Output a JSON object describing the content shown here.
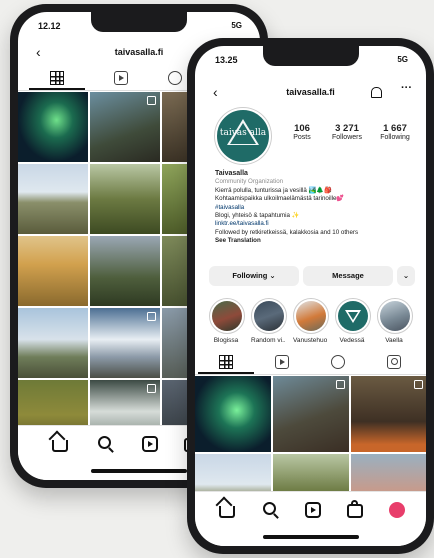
{
  "back_phone": {
    "status_time": "12.12",
    "status_signal": "5G",
    "username": "taivasalla.fi",
    "back_symbol": "‹"
  },
  "front_phone": {
    "status_time": "13.25",
    "status_signal": "5G",
    "username": "taivasalla.fi",
    "back_symbol": "‹",
    "avatar_logo_text": "taivas alla",
    "stats": [
      {
        "value": "106",
        "label": "Posts"
      },
      {
        "value": "3 271",
        "label": "Followers"
      },
      {
        "value": "1 667",
        "label": "Following"
      }
    ],
    "bio": {
      "name": "Taivasalla",
      "category": "Community Organization",
      "line1": "Kierrä polulla, tunturissa ja vesillä 🏞️🌲🎒",
      "line2": "Kohtaamispaikka ulkoilmaelämästä tarinoille💕",
      "hashtag": "#taivasalla",
      "line3": "Blogi, yhteisö & tapahtumia ✨",
      "link": "linktr.ee/taivasalla.fi",
      "followed_by": "Followed by retkiretkeissä, kalakkosia and 10 others",
      "see_translation": "See Translation"
    },
    "buttons": {
      "following": "Following ⌄",
      "message": "Message",
      "more": "⌄"
    },
    "highlights": [
      {
        "label": "Blogissa"
      },
      {
        "label": "Random vi..."
      },
      {
        "label": "Vanustehuol..."
      },
      {
        "label": "Vedessä"
      },
      {
        "label": "Vaella"
      }
    ]
  },
  "icons": {
    "back": "chevron-left-icon",
    "bell": "bell-icon",
    "more": "more-icon",
    "grid": "grid-icon",
    "reels": "reels-icon",
    "guides": "guides-icon",
    "tagged": "tagged-icon",
    "home": "home-icon",
    "search": "search-icon",
    "reels_nav": "reels-icon",
    "shop": "shop-icon"
  },
  "colors": {
    "brand_teal": "#1f6b67",
    "link": "#00376b",
    "avatar_nav": "#e83e6b"
  }
}
